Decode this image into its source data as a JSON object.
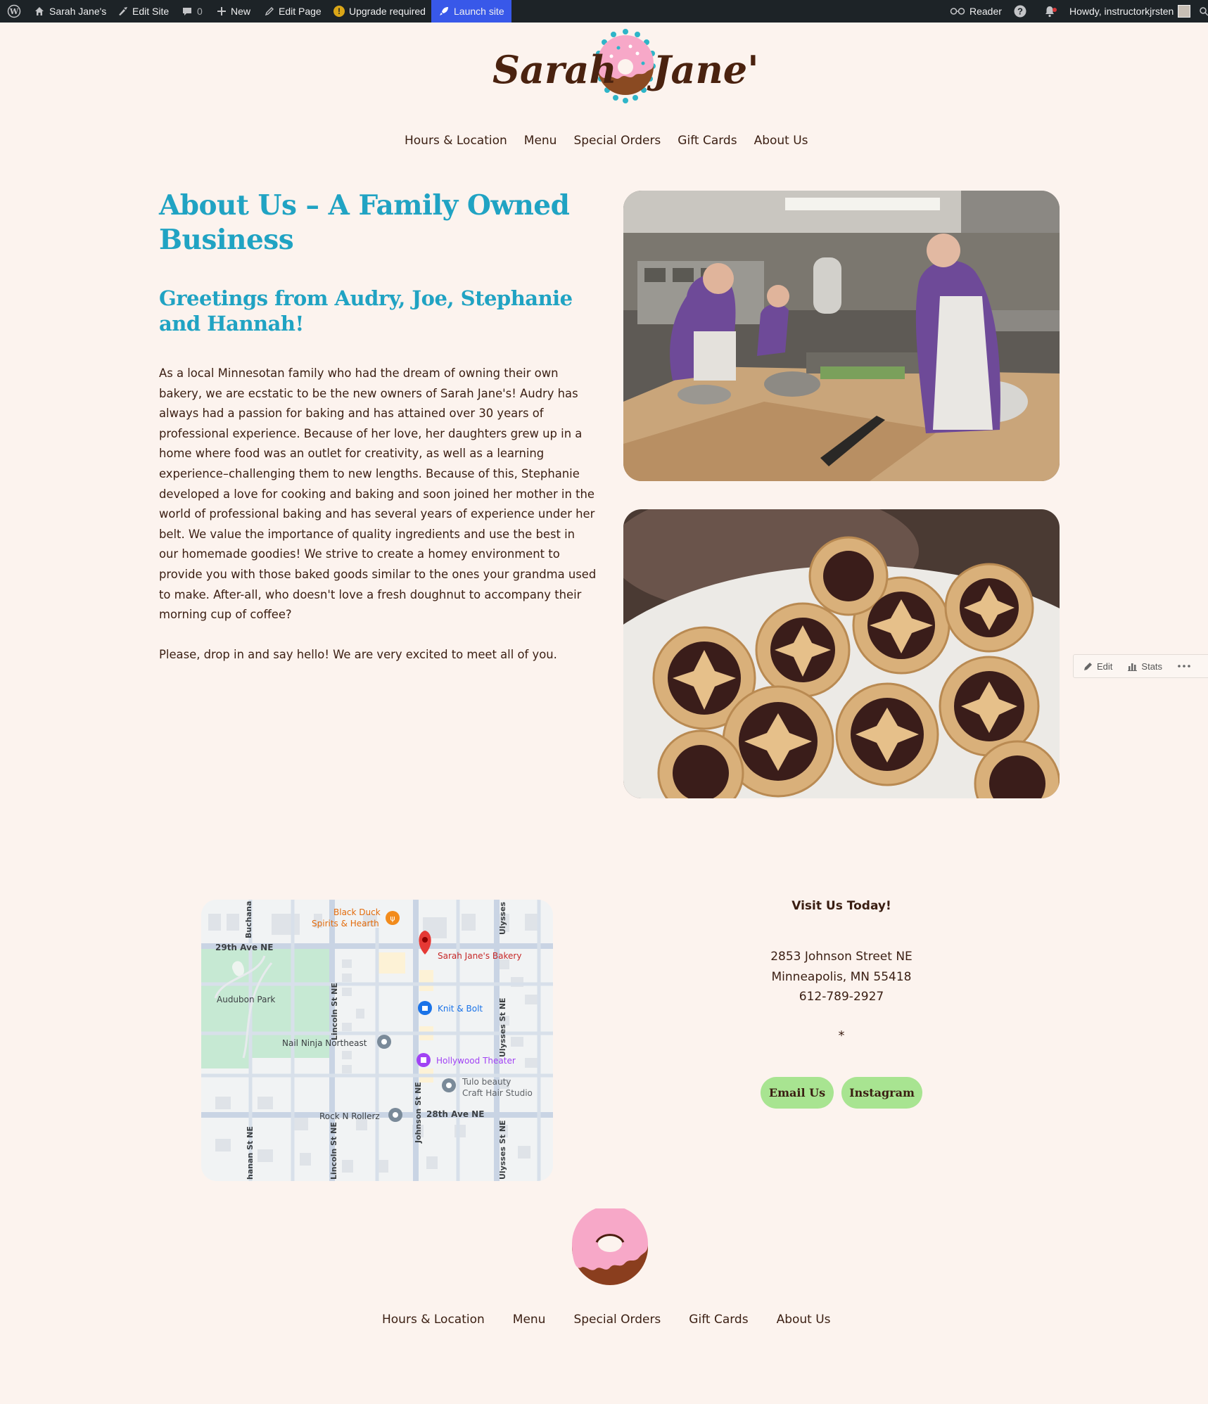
{
  "admin_bar": {
    "site_name": "Sarah Jane's",
    "edit_site": "Edit Site",
    "comments_count": "0",
    "new": "New",
    "edit_page": "Edit Page",
    "upgrade": "Upgrade required",
    "launch": "Launch site",
    "reader": "Reader",
    "howdy": "Howdy, instructorkjrsten"
  },
  "header": {
    "logo_text_left": "Sarah",
    "logo_text_right": "Jane's"
  },
  "nav": {
    "items": [
      "Hours & Location",
      "Menu",
      "Special Orders",
      "Gift Cards",
      "About Us"
    ]
  },
  "content": {
    "title": "About Us – A Family Owned Business",
    "subtitle": "Greetings from Audry, Joe, Stephanie and Hannah!",
    "paragraph1": "As a local Minnesotan family who had the dream of owning their own bakery, we are ecstatic to be the new owners of Sarah Jane's! Audry has always had a passion for baking and has attained over 30 years of professional experience. Because of her love, her daughters grew up in a home where food was an outlet for creativity, as well as a learning experience–challenging them to new lengths. Because of this, Stephanie developed a love for cooking and baking and soon joined her mother in the world of professional baking and has several years of experience under her belt. We value the importance of quality ingredients and use the best in our homemade goodies! We strive to create a homey environment to provide you with those baked goods similar to the ones your grandma used to make. After-all, who doesn't love a fresh doughnut to accompany their morning cup of coffee?",
    "paragraph2": "Please, drop in and say hello! We are very excited to meet all of you."
  },
  "toolbar": {
    "edit": "Edit",
    "stats": "Stats"
  },
  "map": {
    "labels": {
      "black_duck": "Black Duck",
      "spirits": "Spirits & Hearth",
      "ave29": "29th Ave NE",
      "buchanan_top": "Buchana",
      "ulysses_top": "Ulysses",
      "bakery": "Sarah Jane's Bakery",
      "audubon": "Audubon Park",
      "lincoln_top": "Lincoln St NE",
      "knit": "Knit & Bolt",
      "ulysses_mid": "Ulysses St NE",
      "nail": "Nail Ninja Northeast",
      "hollywood": "Hollywood Theater",
      "tulo1": "Tulo beauty",
      "tulo2": "Craft Hair Studio",
      "johnson": "Johnson St NE",
      "rock": "Rock N Rollerz",
      "ave28": "28th Ave NE",
      "buchanan_bottom": "hanan St NE",
      "lincoln_bottom": "Lincoln St NE",
      "ulysses_bottom": "Ulysses St NE"
    }
  },
  "contact": {
    "heading": "Visit Us Today!",
    "street": "2853 Johnson Street NE",
    "city": "Minneapolis, MN 55418",
    "phone": "612-789-2927",
    "asterisk": "*",
    "email_button": "Email Us",
    "instagram_button": "Instagram"
  },
  "colors": {
    "background": "#fcf3ee",
    "heading": "#20a3c3",
    "text": "#3a1e12",
    "button": "#a8e491",
    "admin_bar": "#1d2327",
    "launch": "#3858e9"
  }
}
